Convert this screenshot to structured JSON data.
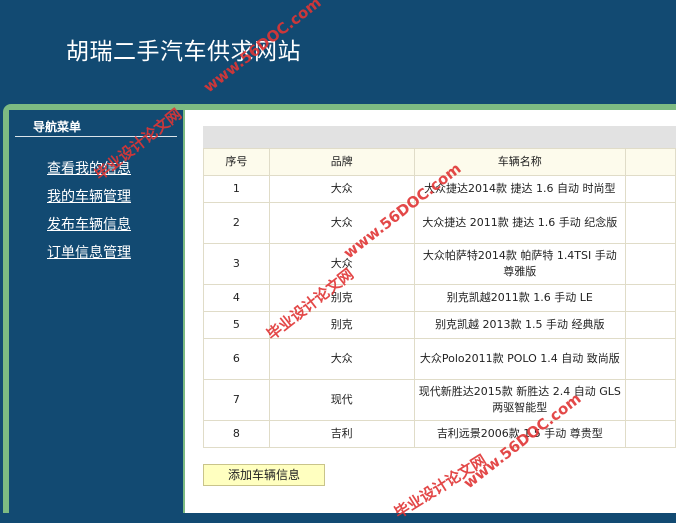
{
  "header": {
    "title": "胡瑞二手汽车供求网站"
  },
  "sidebar": {
    "title": "导航菜单",
    "items": [
      {
        "label": "查看我的信息"
      },
      {
        "label": "我的车辆管理"
      },
      {
        "label": "发布车辆信息"
      },
      {
        "label": "订单信息管理"
      }
    ]
  },
  "table": {
    "columns": [
      "序号",
      "品牌",
      "车辆名称"
    ],
    "rows": [
      {
        "no": "1",
        "brand": "大众",
        "name": "大众捷达2014款 捷达 1.6 自动 时尚型"
      },
      {
        "no": "2",
        "brand": "大众",
        "name": "大众捷达 2011款 捷达 1.6 手动 纪念版"
      },
      {
        "no": "3",
        "brand": "大众",
        "name": "大众帕萨特2014款 帕萨特 1.4TSI 手动 尊雅版"
      },
      {
        "no": "4",
        "brand": "别克",
        "name": "别克凯越2011款 1.6 手动 LE"
      },
      {
        "no": "5",
        "brand": "别克",
        "name": "别克凯越 2013款 1.5 手动 经典版"
      },
      {
        "no": "6",
        "brand": "大众",
        "name": "大众Polo2011款 POLO 1.4 自动 致尚版"
      },
      {
        "no": "7",
        "brand": "现代",
        "name": "现代新胜达2015款 新胜达 2.4 自动 GLS 两驱智能型"
      },
      {
        "no": "8",
        "brand": "吉利",
        "name": "吉利远景2006款 1.5 手动 尊贵型"
      }
    ]
  },
  "actions": {
    "add_label": "添加车辆信息"
  },
  "watermarks": {
    "cn": "毕业设计论文网",
    "url": "www.56DOC.com"
  },
  "colors": {
    "header_bg": "#124a72",
    "accent_green": "#7dbb82",
    "button_bg": "#ffffc0"
  }
}
